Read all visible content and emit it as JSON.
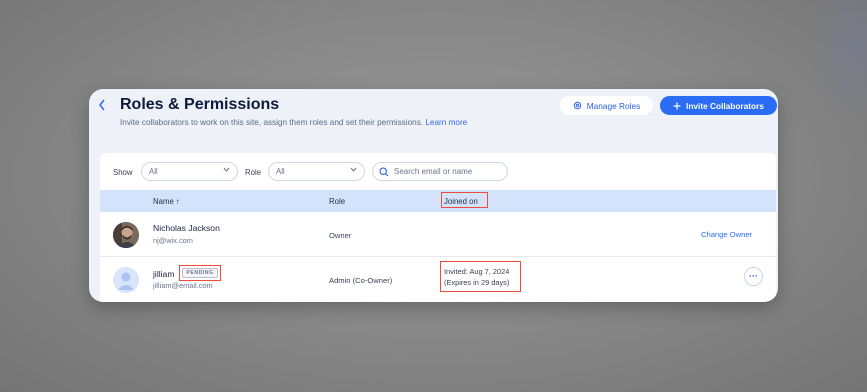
{
  "header": {
    "back_icon": "chevron-left-icon",
    "title": "Roles & Permissions",
    "subtitle": "Invite collaborators to work on this site, assign them roles and set their permissions.",
    "learn_more": "Learn more",
    "manage_roles": "Manage Roles",
    "invite": "Invite Collaborators"
  },
  "filters": {
    "show_label": "Show",
    "show_value": "All",
    "role_label": "Role",
    "role_value": "All",
    "search_placeholder": "Search email or name"
  },
  "table": {
    "columns": {
      "name": "Name ↑",
      "role": "Role",
      "joined": "Joined on"
    },
    "rows": [
      {
        "name": "Nicholas Jackson",
        "email": "nj@wix.com",
        "role": "Owner",
        "action": "Change Owner"
      },
      {
        "name": "jilliam",
        "badge": "PENDING",
        "email": "jilliam@email.com",
        "role": "Admin (Co-Owner)",
        "invited": "Invited: Aug 7, 2024",
        "expires": "(Expires in 29 days)",
        "more": "···"
      }
    ]
  },
  "colors": {
    "accent": "#2a6df4",
    "highlight_box": "#f04a3a",
    "table_header_bg": "#d3e3fb"
  }
}
